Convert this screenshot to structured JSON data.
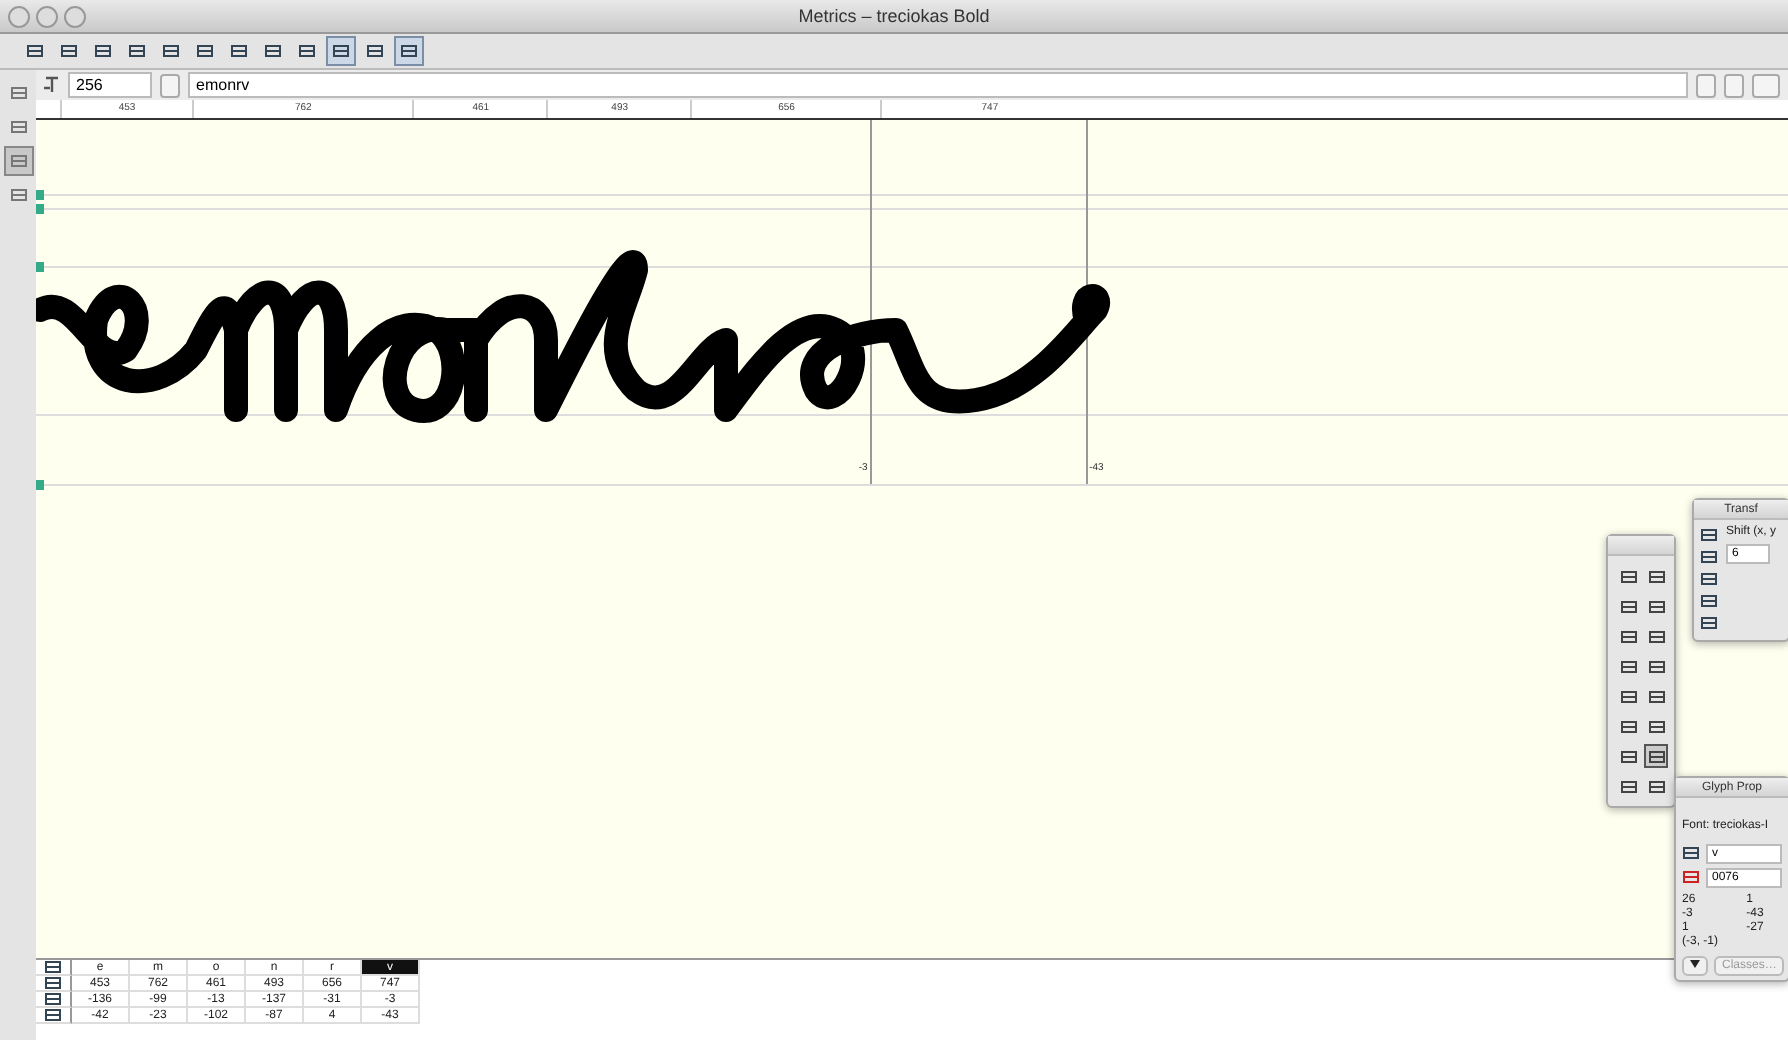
{
  "window": {
    "title": "Metrics – treciokas Bold"
  },
  "toolbar": [
    {
      "selected": false
    },
    {
      "selected": false
    },
    {
      "selected": false
    },
    {
      "selected": false
    },
    {
      "selected": false
    },
    {
      "selected": false
    },
    {
      "selected": false
    },
    {
      "selected": false
    },
    {
      "selected": false
    },
    {
      "selected": true
    },
    {
      "selected": false
    },
    {
      "selected": true
    }
  ],
  "tools": [
    {
      "selected": false
    },
    {
      "selected": false
    },
    {
      "selected": true
    },
    {
      "selected": false
    }
  ],
  "size_field": {
    "value": "256"
  },
  "text_field": {
    "value": "emonrv"
  },
  "ruler": [
    "453",
    "762",
    "461",
    "493",
    "656",
    "747"
  ],
  "canvas": {
    "labels": [
      "-3",
      "-43"
    ]
  },
  "tool_palette": [
    {
      "selected": false
    },
    {
      "selected": false
    },
    {
      "selected": false
    },
    {
      "selected": false
    },
    {
      "selected": false
    },
    {
      "selected": false
    },
    {
      "selected": false
    },
    {
      "selected": false
    },
    {
      "selected": false
    },
    {
      "selected": false
    },
    {
      "selected": false
    },
    {
      "selected": false
    },
    {
      "selected": false
    },
    {
      "selected": true
    },
    {
      "selected": false
    },
    {
      "selected": false
    }
  ],
  "transform_panel": {
    "title": "Transf",
    "label": "Shift (x, y",
    "value": "6"
  },
  "glyph_panel": {
    "title": "Glyph Prop",
    "font": "Font: treciokas-I",
    "name": "v",
    "unicode": "0076",
    "metrics": [
      "26",
      "1",
      "-3",
      "-43",
      "1",
      "-27",
      "(-3, -1)"
    ],
    "button": "Classes…"
  },
  "table": {
    "glyphs": [
      {
        "name": "e",
        "selected": false
      },
      {
        "name": "m",
        "selected": false
      },
      {
        "name": "o",
        "selected": false
      },
      {
        "name": "n",
        "selected": false
      },
      {
        "name": "r",
        "selected": false
      },
      {
        "name": "v",
        "selected": true
      }
    ],
    "rows": [
      [
        "453",
        "762",
        "461",
        "493",
        "656",
        "747"
      ],
      [
        "-136",
        "-99",
        "-13",
        "-137",
        "-31",
        "-3"
      ],
      [
        "-42",
        "-23",
        "-102",
        "-87",
        "4",
        "-43"
      ]
    ]
  }
}
